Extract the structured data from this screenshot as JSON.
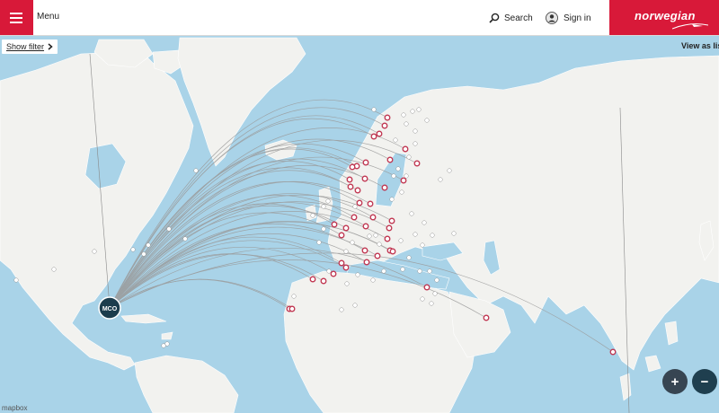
{
  "header": {
    "menu_label": "Menu",
    "search_label": "Search",
    "signin_label": "Sign in",
    "brand_text": "norwegian"
  },
  "controls": {
    "filter_label": "Show filter",
    "view_list_label": "View as lis",
    "zoom_in_label": "+",
    "zoom_out_label": "−",
    "attribution": "mapbox"
  },
  "origin_label": "MCO",
  "icons": [
    "menu-icon",
    "search-icon",
    "user-icon",
    "chevron-right-icon",
    "plane-swoosh-icon"
  ],
  "colors": {
    "brand": "#d81939",
    "water": "#a9d3e8",
    "land": "#f2f2ef",
    "route": "#9a9a9a",
    "destination_ring": "#c0344f",
    "origin_marker": "#1c3d4d",
    "zoom_dark": "#374552",
    "zoom_navy": "#1f3f4f"
  },
  "destinations_marked": 42,
  "destinations_unmarked": 60
}
